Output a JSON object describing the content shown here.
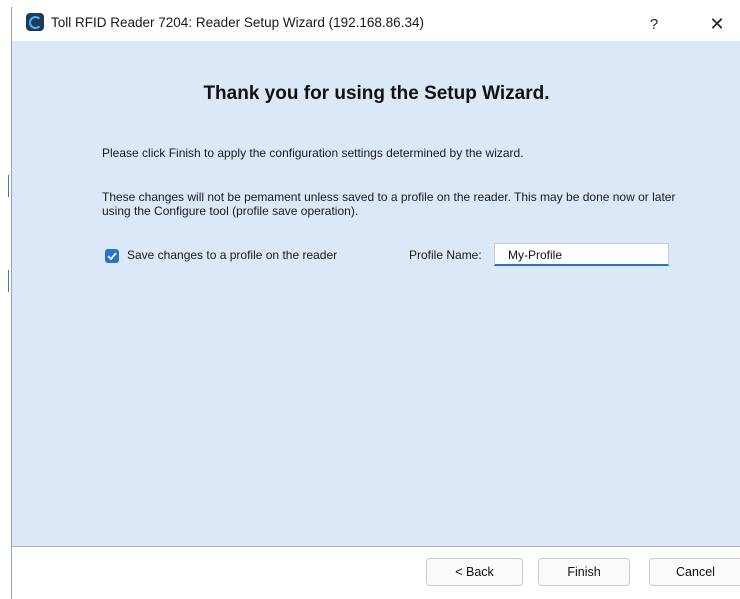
{
  "window": {
    "title": "Toll RFID Reader 7204: Reader Setup Wizard (192.168.86.34)",
    "help_label": "?",
    "close_label": "✕"
  },
  "wizard": {
    "heading": "Thank you for using the Setup Wizard.",
    "finish_instruction": "Please click Finish to apply the configuration settings determined by the wizard.",
    "persistence_note": "These changes will not be pemament unless saved to a profile on the reader. This may be done now or later using the Configure tool (profile save operation).",
    "save_checkbox": {
      "label": "Save changes to a profile on the reader",
      "checked": true
    },
    "profile_name": {
      "label": "Profile Name:",
      "value": "My-Profile"
    }
  },
  "footer": {
    "back_label": "< Back",
    "finish_label": "Finish",
    "cancel_label": "Cancel"
  },
  "colors": {
    "content_background": "#dbe8f8",
    "accent": "#2b73c9"
  }
}
